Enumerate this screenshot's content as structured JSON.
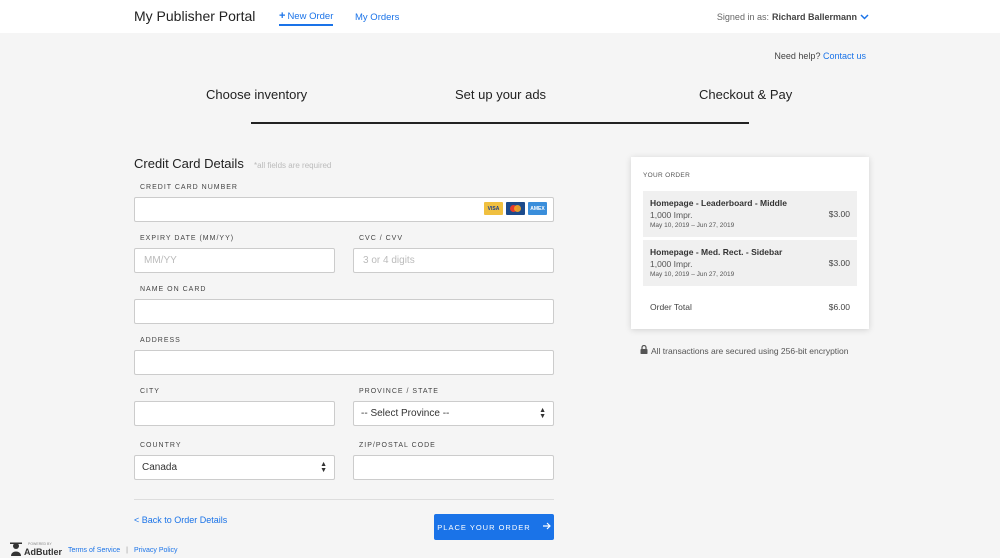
{
  "header": {
    "brand": "My Publisher Portal",
    "new_order": "New Order",
    "my_orders": "My Orders",
    "signed_in_prefix": "Signed in as:",
    "user": "Richard Ballermann"
  },
  "help": {
    "text": "Need help?",
    "link": "Contact us"
  },
  "steps": [
    "Choose inventory",
    "Set up your ads",
    "Checkout & Pay"
  ],
  "form": {
    "title": "Credit Card Details",
    "required_note": "*all fields are required",
    "card_number_label": "CREDIT CARD NUMBER",
    "card_brands": {
      "visa": "VISA",
      "mastercard": "",
      "amex": "AMEX"
    },
    "expiry_label": "EXPIRY DATE (MM/YY)",
    "expiry_placeholder": "MM/YY",
    "cvc_label": "CVC / CVV",
    "cvc_placeholder": "3 or 4 digits",
    "name_label": "NAME ON CARD",
    "address_label": "ADDRESS",
    "city_label": "CITY",
    "province_label": "PROVINCE / STATE",
    "province_value": "-- Select Province --",
    "country_label": "COUNTRY",
    "country_value": "Canada",
    "zip_label": "ZIP/POSTAL CODE",
    "back_link": "< Back to Order Details",
    "place_order": "PLACE YOUR ORDER"
  },
  "order": {
    "title": "YOUR ORDER",
    "items": [
      {
        "name": "Homepage - Leaderboard - Middle",
        "impressions": "1,000 Impr.",
        "dates": "May 10, 2019 – Jun 27, 2019",
        "price": "$3.00"
      },
      {
        "name": "Homepage - Med. Rect. - Sidebar",
        "impressions": "1,000 Impr.",
        "dates": "May 10, 2019 – Jun 27, 2019",
        "price": "$3.00"
      }
    ],
    "total_label": "Order Total",
    "total_value": "$6.00"
  },
  "secure_note": "All transactions are secured using 256-bit encryption",
  "footer": {
    "powered_by": "POWERED BY",
    "logo": "AdButler",
    "terms": "Terms of Service",
    "separator": "|",
    "privacy": "Privacy Policy"
  },
  "colors": {
    "accent": "#1a73e8",
    "background": "#f5f5f5"
  }
}
